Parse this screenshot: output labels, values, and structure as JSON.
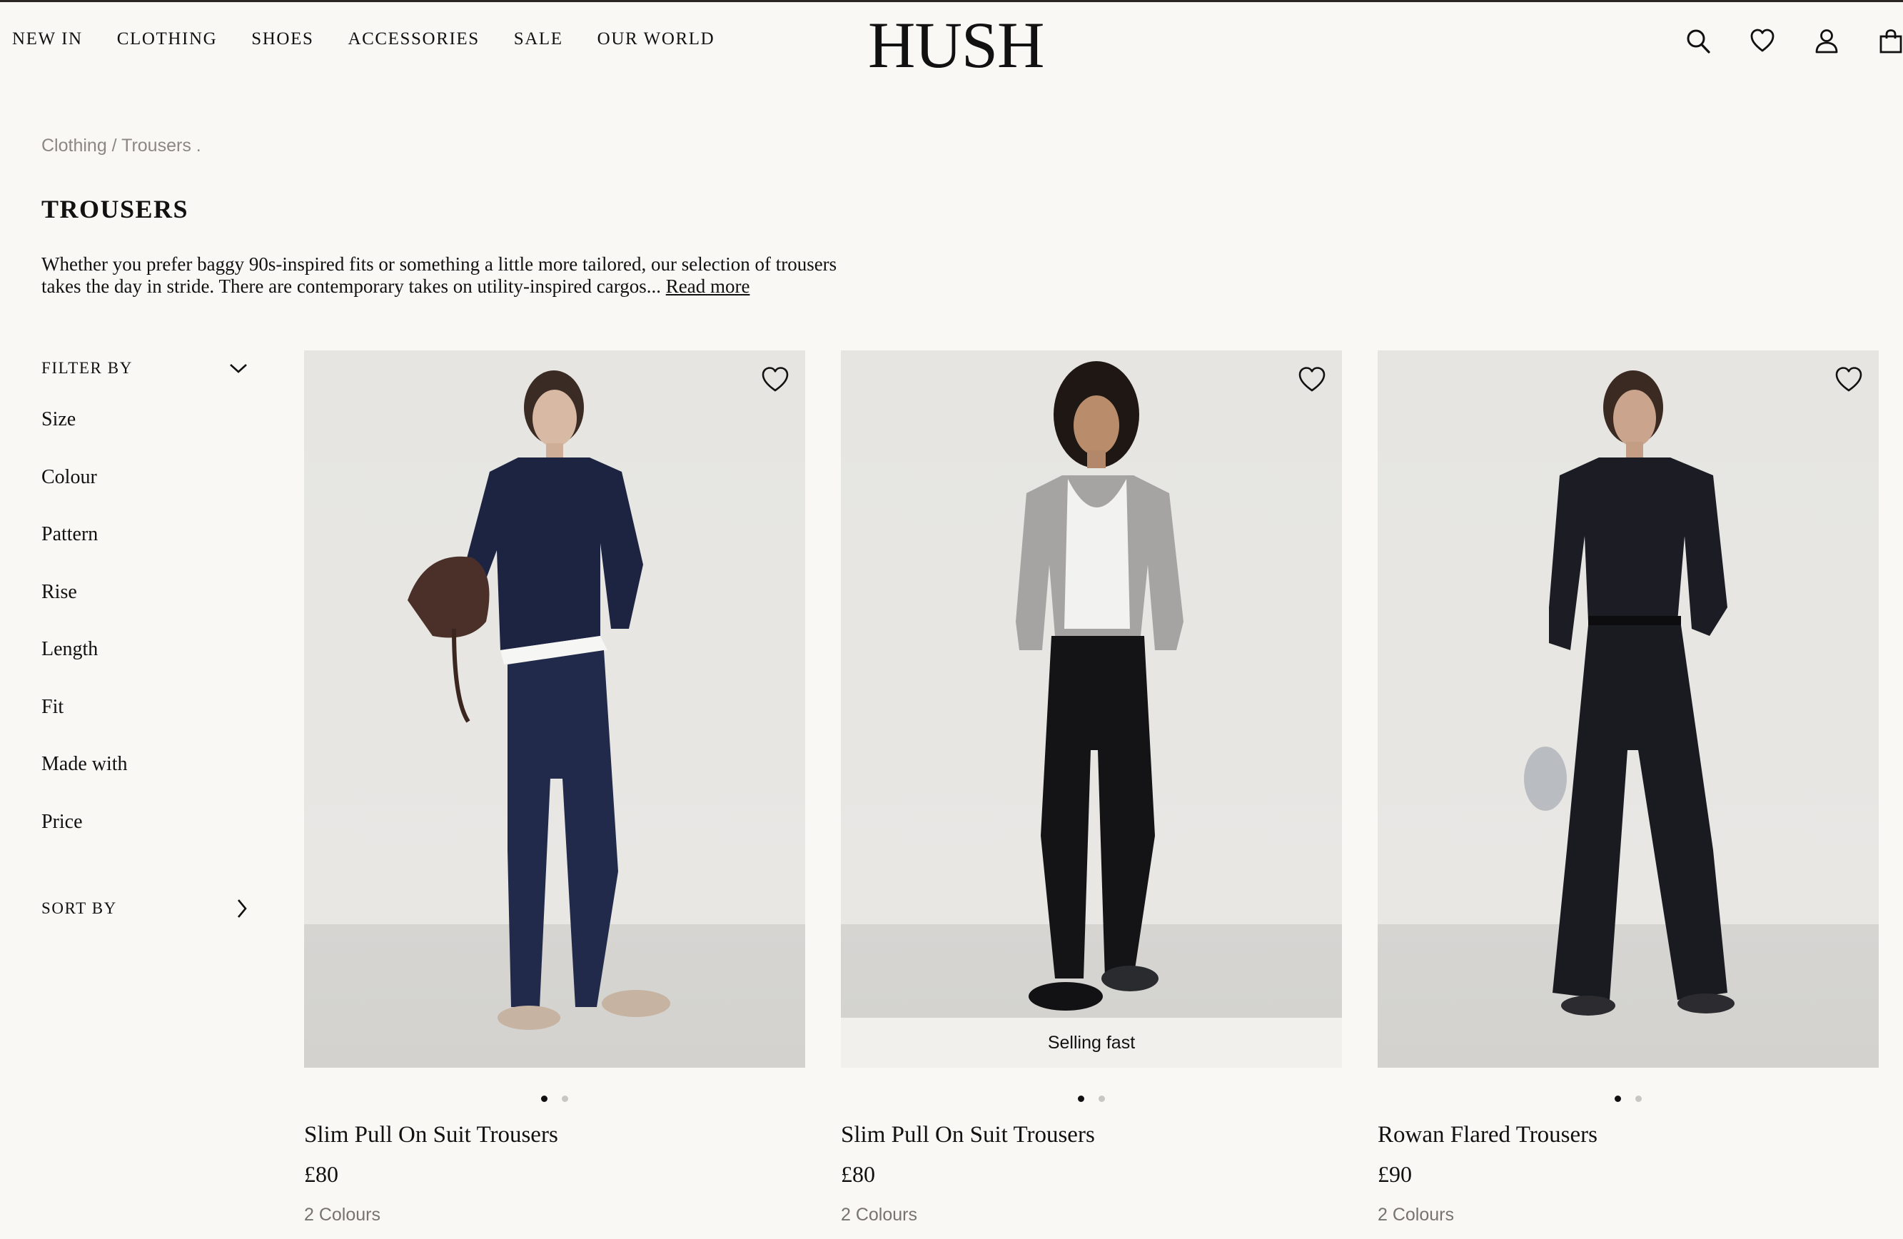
{
  "nav": {
    "items": [
      {
        "label": "NEW IN"
      },
      {
        "label": "CLOTHING"
      },
      {
        "label": "SHOES"
      },
      {
        "label": "ACCESSORIES"
      },
      {
        "label": "SALE"
      },
      {
        "label": "OUR WORLD"
      }
    ],
    "logo": "HUSH",
    "icons": [
      "search-icon",
      "heart-icon",
      "account-icon",
      "bag-icon"
    ]
  },
  "breadcrumb": {
    "text": "Clothing / Trousers ."
  },
  "page": {
    "title": "TROUSERS",
    "intro": "Whether you prefer baggy 90s-inspired fits or something a little more tailored, our selection of trousers takes the day in stride. There are contemporary takes on utility-inspired cargos...",
    "read_more": "Read more"
  },
  "filters": {
    "filter_by": "FILTER BY",
    "items": [
      {
        "label": "Size"
      },
      {
        "label": "Colour"
      },
      {
        "label": "Pattern"
      },
      {
        "label": "Rise"
      },
      {
        "label": "Length"
      },
      {
        "label": "Fit"
      },
      {
        "label": "Made with"
      },
      {
        "label": "Price"
      }
    ],
    "sort_by": "SORT BY"
  },
  "products": [
    {
      "name": "Slim Pull On Suit Trousers",
      "price": "£80",
      "colours": "2 Colours",
      "badge": "",
      "image_slide": 1,
      "image_count": 2,
      "top_color": "#1d2442",
      "bottom_color": "#212a4a"
    },
    {
      "name": "Slim Pull On Suit Trousers",
      "price": "£80",
      "colours": "2 Colours",
      "badge": "Selling fast",
      "image_slide": 1,
      "image_count": 2,
      "top_color": "#a5a4a3",
      "bottom_color": "#141416"
    },
    {
      "name": "Rowan Flared Trousers",
      "price": "£90",
      "colours": "2 Colours",
      "badge": "",
      "image_slide": 1,
      "image_count": 2,
      "top_color": "#1c1d24",
      "bottom_color": "#1a1b21"
    }
  ],
  "colors": {
    "background": "#f9f8f5",
    "text": "#111111",
    "muted": "#8b8884"
  }
}
